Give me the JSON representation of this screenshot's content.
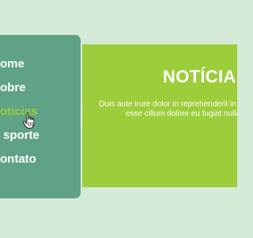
{
  "menu": {
    "items": [
      {
        "label": "ome"
      },
      {
        "label": "obre"
      },
      {
        "label": "oticias"
      },
      {
        "label": "sporte"
      },
      {
        "label": "ontato"
      }
    ]
  },
  "panel": {
    "title": "NOTÍCIA",
    "text": "Duis aute irure dolor in reprehenderit in voluptate velit esse cillum dolore eu fugiat nulla paria"
  },
  "colors": {
    "background": "#d6ead8",
    "menu": "#5fa286",
    "panel": "#9ccd3a",
    "active_item": "#9ccd3a"
  },
  "icons": {
    "cursor": "hand-pointer-icon"
  }
}
